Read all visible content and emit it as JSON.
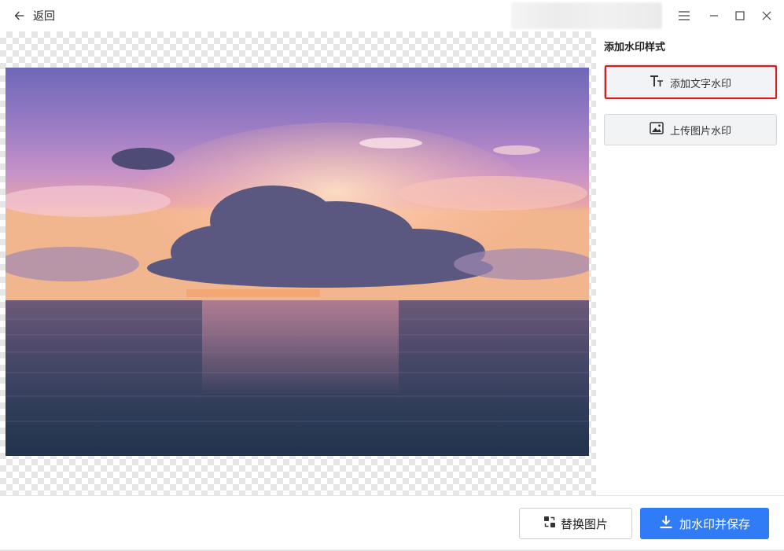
{
  "header": {
    "back_label": "返回"
  },
  "panel": {
    "title": "添加水印样式",
    "text_watermark_label": "添加文字水印",
    "image_watermark_label": "上传图片水印"
  },
  "footer": {
    "replace_label": "替换图片",
    "save_label": "加水印并保存"
  },
  "colors": {
    "primary": "#2f7cf6",
    "highlight": "#d31f1f"
  },
  "icons": {
    "back": "arrow-left-icon",
    "menu": "menu-icon",
    "minimize": "minimize-icon",
    "maximize": "maximize-icon",
    "close": "close-icon",
    "text": "text-icon",
    "image": "image-icon",
    "replace": "swap-icon",
    "save": "download-icon"
  }
}
